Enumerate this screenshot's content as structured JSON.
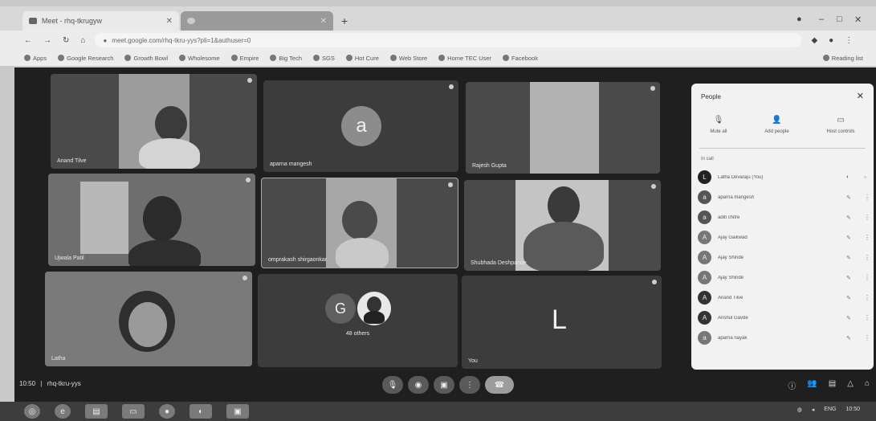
{
  "browser": {
    "tab_active_title": "Meet - rhq-tkrugyw",
    "tab_second_title": "",
    "url": "meet.google.com/rhq-tkru-yys?pli=1&authuser=0",
    "bookmarks": [
      "Apps",
      "Google Research",
      "Growth Bowl",
      "Wholesome",
      "Empire",
      "Big Tech",
      "SGS",
      "Hot Cure",
      "Web Store",
      "Home TEC User",
      "Facebook"
    ],
    "bookmarks_right": "Reading list"
  },
  "tiles": [
    {
      "name": "Anand Tilve",
      "kind": "video"
    },
    {
      "name": "aparna mangesh",
      "kind": "avatar",
      "letter": "a"
    },
    {
      "name": "Rajesh Gupta",
      "kind": "video"
    },
    {
      "name": "Ujwala Patil",
      "kind": "video"
    },
    {
      "name": "omprakash shirgaonkar",
      "kind": "video"
    },
    {
      "name": "Shubhada Deshpande",
      "kind": "video"
    },
    {
      "name": "Latha",
      "kind": "video"
    },
    {
      "name": "48 others",
      "kind": "group",
      "letter": "G"
    },
    {
      "name": "You",
      "kind": "avatar",
      "letter": "L"
    }
  ],
  "panel": {
    "title": "People",
    "actions": [
      "Mute all",
      "Add people",
      "Host controls"
    ],
    "section": "In call",
    "participants": [
      {
        "letter": "L",
        "name": "Latha Devaraju (You)"
      },
      {
        "letter": "a",
        "name": "aparna mangesh"
      },
      {
        "letter": "a",
        "name": "aditi chitre"
      },
      {
        "letter": "A",
        "name": "Ajay Gaikwad"
      },
      {
        "letter": "A",
        "name": "Ajay Shinde"
      },
      {
        "letter": "A",
        "name": "Ajay Shinde"
      },
      {
        "letter": "A",
        "name": "Anand Tilve"
      },
      {
        "letter": "A",
        "name": "Anshul Gavde"
      },
      {
        "letter": "a",
        "name": "aparna nayak"
      }
    ]
  },
  "meetbar": {
    "time": "10:50",
    "code": "rhq-tkru-yys"
  },
  "tray": {
    "lang": "ENG",
    "clock": "10:50"
  },
  "colors": {
    "meet_bg": "#1f1f1f",
    "tile_bg": "#3c3c3c",
    "panel_bg": "#f2f2f2"
  }
}
